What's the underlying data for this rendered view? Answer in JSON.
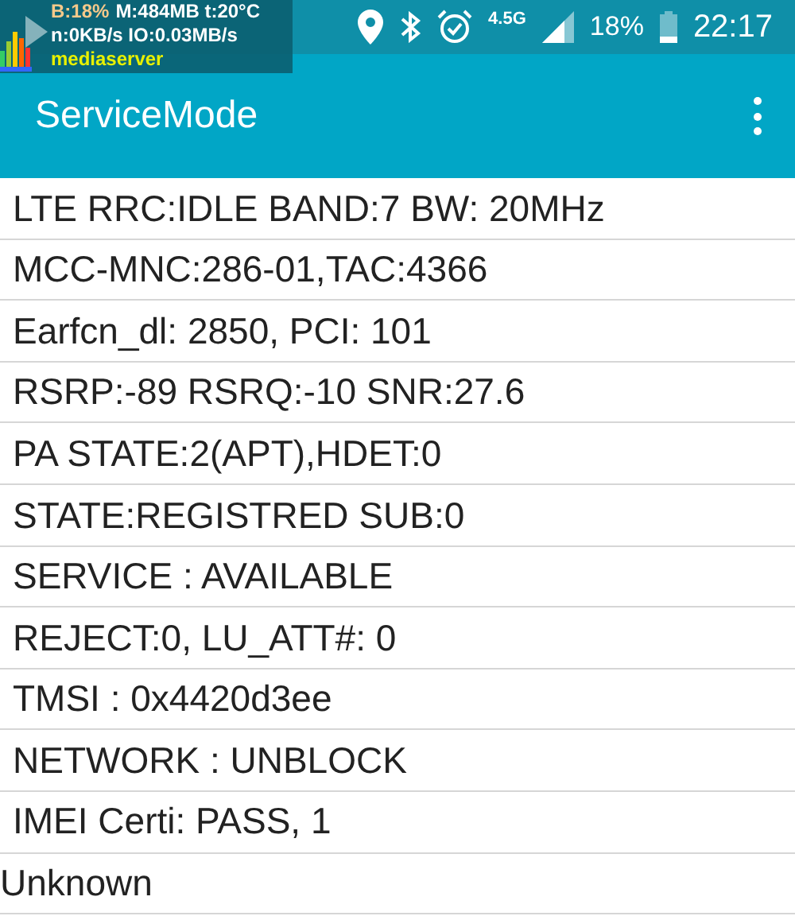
{
  "overlay": {
    "battery": "B:18%",
    "memory": "M:484MB t:20°C",
    "io": "n:0KB/s IO:0.03MB/s",
    "process": "mediaserver"
  },
  "status_bar": {
    "network": "4.5G",
    "battery": "18%",
    "time": "22:17"
  },
  "app_bar": {
    "title": "ServiceMode"
  },
  "rows": [
    {
      "text": "LTE RRC:IDLE BAND:7 BW: 20MHz",
      "kind": "item"
    },
    {
      "text": "MCC-MNC:286-01,TAC:4366",
      "kind": "item"
    },
    {
      "text": "Earfcn_dl: 2850, PCI: 101",
      "kind": "item"
    },
    {
      "text": "RSRP:-89 RSRQ:-10 SNR:27.6",
      "kind": "item"
    },
    {
      "text": "PA STATE:2(APT),HDET:0",
      "kind": "item"
    },
    {
      "text": "STATE:REGISTRED SUB:0",
      "kind": "item"
    },
    {
      "text": "SERVICE : AVAILABLE",
      "kind": "item"
    },
    {
      "text": "REJECT:0, LU_ATT#: 0",
      "kind": "item"
    },
    {
      "text": "TMSI : 0x4420d3ee",
      "kind": "item"
    },
    {
      "text": "NETWORK : UNBLOCK",
      "kind": "item"
    },
    {
      "text": "IMEI Certi: PASS, 1",
      "kind": "item"
    },
    {
      "text": "Unknown",
      "kind": "flush"
    }
  ]
}
